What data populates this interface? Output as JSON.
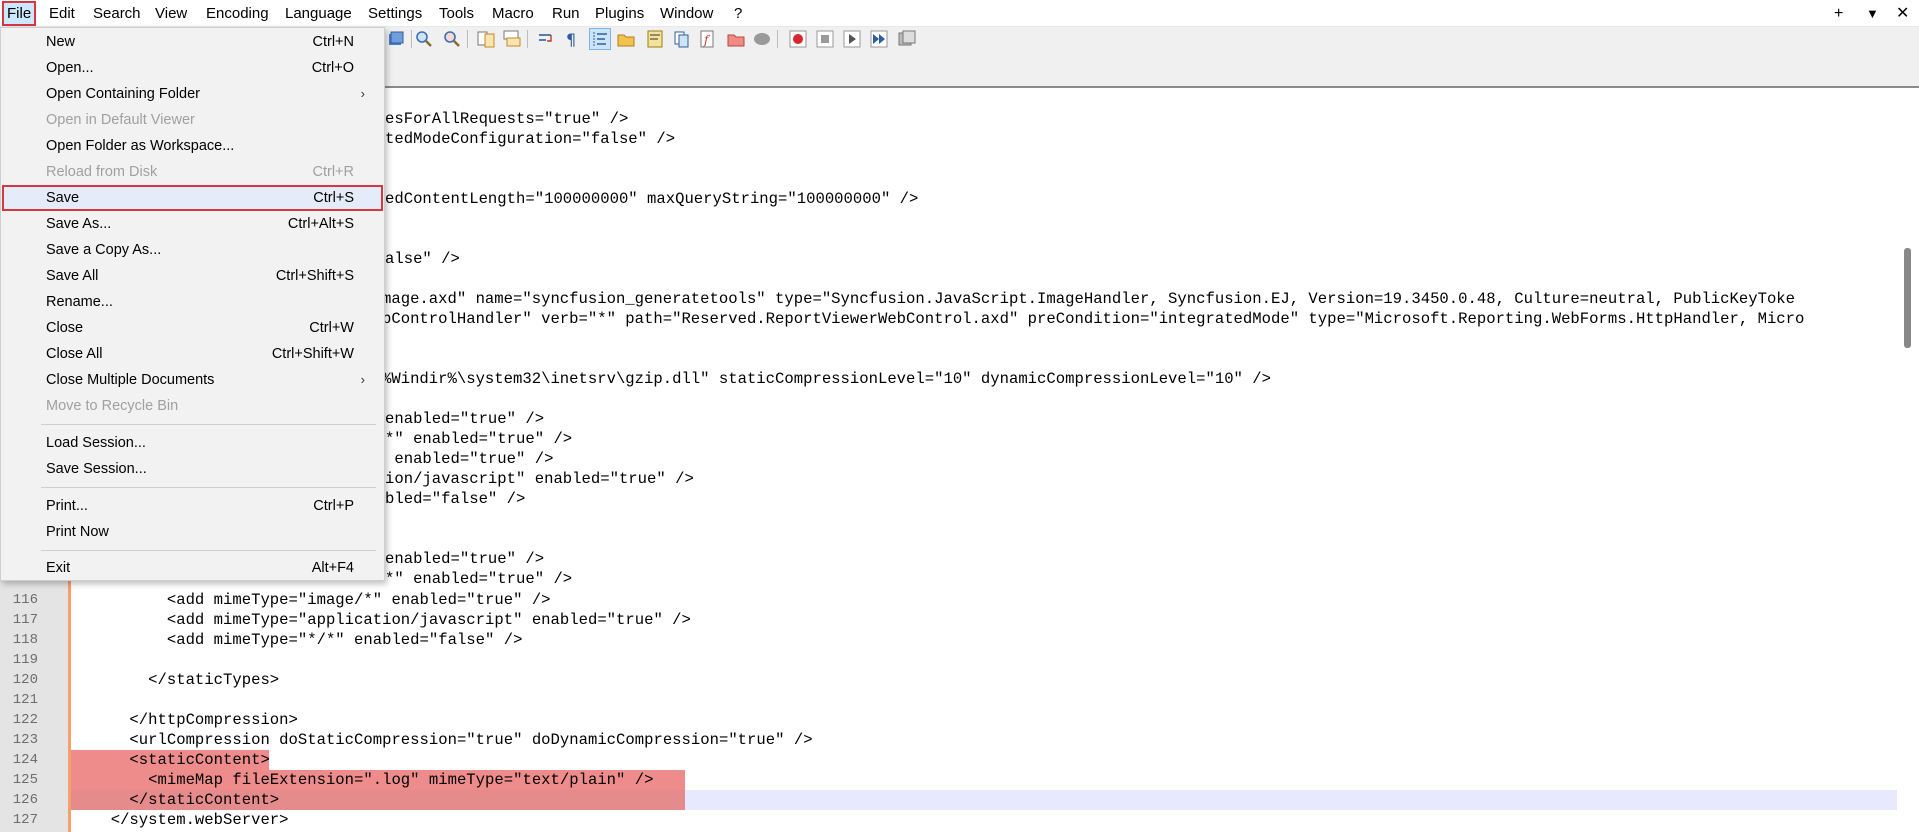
{
  "menubar": {
    "items": [
      "File",
      "Edit",
      "Search",
      "View",
      "Encoding",
      "Language",
      "Settings",
      "Tools",
      "Macro",
      "Run",
      "Plugins",
      "Window",
      "?"
    ],
    "active": "File",
    "controls": [
      "+",
      "▼",
      "✕"
    ]
  },
  "file_menu": {
    "items": [
      {
        "label": "New",
        "shortcut": "Ctrl+N",
        "enabled": true
      },
      {
        "label": "Open...",
        "shortcut": "Ctrl+O",
        "enabled": true
      },
      {
        "label": "Open Containing Folder",
        "shortcut": "",
        "submenu": true,
        "enabled": true
      },
      {
        "label": "Open in Default Viewer",
        "shortcut": "",
        "enabled": false
      },
      {
        "label": "Open Folder as Workspace...",
        "shortcut": "",
        "enabled": true
      },
      {
        "label": "Reload from Disk",
        "shortcut": "Ctrl+R",
        "enabled": false
      },
      {
        "label": "Save",
        "shortcut": "Ctrl+S",
        "enabled": true,
        "highlighted": true
      },
      {
        "label": "Save As...",
        "shortcut": "Ctrl+Alt+S",
        "enabled": true
      },
      {
        "label": "Save a Copy As...",
        "shortcut": "",
        "enabled": true
      },
      {
        "label": "Save All",
        "shortcut": "Ctrl+Shift+S",
        "enabled": true
      },
      {
        "label": "Rename...",
        "shortcut": "",
        "enabled": true
      },
      {
        "label": "Close",
        "shortcut": "Ctrl+W",
        "enabled": true
      },
      {
        "label": "Close All",
        "shortcut": "Ctrl+Shift+W",
        "enabled": true
      },
      {
        "label": "Close Multiple Documents",
        "shortcut": "",
        "submenu": true,
        "enabled": true
      },
      {
        "label": "Move to Recycle Bin",
        "shortcut": "",
        "enabled": false
      },
      {
        "label": "Load Session...",
        "shortcut": "",
        "enabled": true
      },
      {
        "label": "Save Session...",
        "shortcut": "",
        "enabled": true
      },
      {
        "label": "Print...",
        "shortcut": "Ctrl+P",
        "enabled": true
      },
      {
        "label": "Print Now",
        "shortcut": "",
        "enabled": true
      },
      {
        "label": "Exit",
        "shortcut": "Alt+F4",
        "enabled": true
      }
    ]
  },
  "editor": {
    "visible_code_right_of_menu": [
      "esForAllRequests=\"true\" />",
      "tedModeConfiguration=\"false\" />",
      "",
      "edContentLength=\"100000000\" maxQueryString=\"100000000\" />",
      "",
      "alse\" />",
      "",
      "mage.axd\" name=\"syncfusion_generatetools\" type=\"Syncfusion.JavaScript.ImageHandler, Syncfusion.EJ, Version=19.3450.0.48, Culture=neutral, PublicKeyToke",
      "bControlHandler\" verb=\"*\" path=\"Reserved.ReportViewerWebControl.axd\" preCondition=\"integratedMode\" type=\"Microsoft.Reporting.WebForms.HttpHandler, Micro",
      "",
      "%Windir%\\system32\\inetsrv\\gzip.dll\" staticCompressionLevel=\"10\" dynamicCompressionLevel=\"10\" />",
      "",
      "enabled=\"true\" />",
      "*\" enabled=\"true\" />",
      " enabled=\"true\" />",
      "ion/javascript\" enabled=\"true\" />",
      "bled=\"false\" />",
      "",
      "",
      "enabled=\"true\" />",
      "*\" enabled=\"true\" />"
    ],
    "full_lines": [
      {
        "num": "116",
        "text": "        <add mimeType=\"image/*\" enabled=\"true\" />"
      },
      {
        "num": "117",
        "text": "        <add mimeType=\"application/javascript\" enabled=\"true\" />"
      },
      {
        "num": "118",
        "text": "        <add mimeType=\"*/*\" enabled=\"false\" />"
      },
      {
        "num": "119",
        "text": ""
      },
      {
        "num": "120",
        "text": "      </staticTypes>"
      },
      {
        "num": "121",
        "text": ""
      },
      {
        "num": "122",
        "text": "    </httpCompression>"
      },
      {
        "num": "123",
        "text": "    <urlCompression doStaticCompression=\"true\" doDynamicCompression=\"true\" />"
      },
      {
        "num": "124",
        "text": "    <staticContent>"
      },
      {
        "num": "125",
        "text": "      <mimeMap fileExtension=\".log\" mimeType=\"text/plain\" />"
      },
      {
        "num": "126",
        "text": "    </staticContent>"
      },
      {
        "num": "127",
        "text": "  </system.webServer>"
      }
    ],
    "selected_lines": [
      "124",
      "125",
      "126"
    ],
    "caret_line": "126"
  },
  "colors": {
    "highlight_border": "#d9363e",
    "selection": "#ee8c8c",
    "caret_line": "#e8e8ff",
    "fold_margin": "#f7a069"
  }
}
